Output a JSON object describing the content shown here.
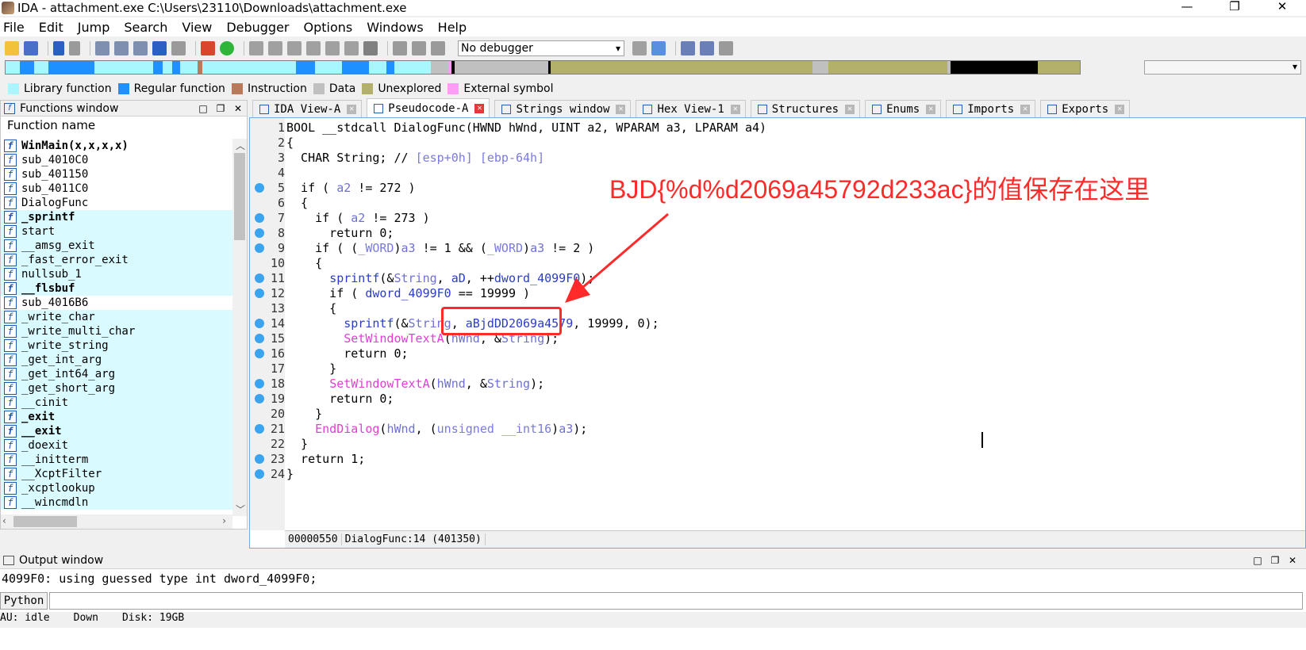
{
  "window": {
    "title": "IDA - attachment.exe C:\\Users\\23110\\Downloads\\attachment.exe",
    "min_label": "—",
    "max_label": "❐",
    "close_label": "✕"
  },
  "menu": [
    "File",
    "Edit",
    "Jump",
    "Search",
    "View",
    "Debugger",
    "Options",
    "Windows",
    "Help"
  ],
  "toolbar": {
    "debugger_select": "No debugger"
  },
  "legend": [
    {
      "label": "Library function",
      "color": "#aaf6ff"
    },
    {
      "label": "Regular function",
      "color": "#1e90ff"
    },
    {
      "label": "Instruction",
      "color": "#b87a5a"
    },
    {
      "label": "Data",
      "color": "#c0c0c0"
    },
    {
      "label": "Unexplored",
      "color": "#b2b06a"
    },
    {
      "label": "External symbol",
      "color": "#ff9cf5"
    }
  ],
  "functions_window": {
    "title": "Functions window",
    "column": "Function name",
    "items": [
      {
        "name": "WinMain(x,x,x,x)",
        "lib": false,
        "bold": true
      },
      {
        "name": "sub_4010C0",
        "lib": false,
        "bold": false
      },
      {
        "name": "sub_401150",
        "lib": false,
        "bold": false
      },
      {
        "name": "sub_4011C0",
        "lib": false,
        "bold": false
      },
      {
        "name": "DialogFunc",
        "lib": false,
        "bold": false
      },
      {
        "name": "_sprintf",
        "lib": true,
        "bold": true
      },
      {
        "name": "start",
        "lib": true,
        "bold": false
      },
      {
        "name": "__amsg_exit",
        "lib": true,
        "bold": false
      },
      {
        "name": "_fast_error_exit",
        "lib": true,
        "bold": false
      },
      {
        "name": "nullsub_1",
        "lib": true,
        "bold": false
      },
      {
        "name": "__flsbuf",
        "lib": true,
        "bold": true
      },
      {
        "name": "sub_4016B6",
        "lib": false,
        "bold": false
      },
      {
        "name": "_write_char",
        "lib": true,
        "bold": false
      },
      {
        "name": "_write_multi_char",
        "lib": true,
        "bold": false
      },
      {
        "name": "_write_string",
        "lib": true,
        "bold": false
      },
      {
        "name": "_get_int_arg",
        "lib": true,
        "bold": false
      },
      {
        "name": "_get_int64_arg",
        "lib": true,
        "bold": false
      },
      {
        "name": "_get_short_arg",
        "lib": true,
        "bold": false
      },
      {
        "name": "__cinit",
        "lib": true,
        "bold": false
      },
      {
        "name": "_exit",
        "lib": true,
        "bold": true
      },
      {
        "name": "__exit",
        "lib": true,
        "bold": true
      },
      {
        "name": "_doexit",
        "lib": true,
        "bold": false
      },
      {
        "name": "__initterm",
        "lib": true,
        "bold": false
      },
      {
        "name": "__XcptFilter",
        "lib": true,
        "bold": false
      },
      {
        "name": "_xcptlookup",
        "lib": true,
        "bold": false
      },
      {
        "name": "__wincmdln",
        "lib": true,
        "bold": false
      }
    ]
  },
  "tabs": [
    {
      "label": "IDA View-A",
      "active": false
    },
    {
      "label": "Pseudocode-A",
      "active": true
    },
    {
      "label": "Strings window",
      "active": false
    },
    {
      "label": "Hex View-1",
      "active": false
    },
    {
      "label": "Structures",
      "active": false
    },
    {
      "label": "Enums",
      "active": false
    },
    {
      "label": "Imports",
      "active": false
    },
    {
      "label": "Exports",
      "active": false
    }
  ],
  "code": [
    {
      "n": "1",
      "dot": false,
      "html": "BOOL __stdcall DialogFunc(HWND hWnd, UINT a2, WPARAM a3, LPARAM a4)"
    },
    {
      "n": "2",
      "dot": false,
      "html": "{"
    },
    {
      "n": "3",
      "dot": false,
      "html": "  CHAR String; // <span class='cmt'>[esp+0h] [ebp-64h]</span>"
    },
    {
      "n": "4",
      "dot": false,
      "html": ""
    },
    {
      "n": "5",
      "dot": true,
      "html": "  if ( <span class='var'>a2</span> != 272 )"
    },
    {
      "n": "6",
      "dot": false,
      "html": "  {"
    },
    {
      "n": "7",
      "dot": true,
      "html": "    if ( <span class='var'>a2</span> != 273 )"
    },
    {
      "n": "8",
      "dot": true,
      "html": "      return 0;"
    },
    {
      "n": "9",
      "dot": true,
      "html": "    if ( (<span class='cmt'>_WORD</span>)<span class='var'>a3</span> != 1 && (<span class='cmt'>_WORD</span>)<span class='var'>a3</span> != 2 )"
    },
    {
      "n": "10",
      "dot": false,
      "html": "    {"
    },
    {
      "n": "11",
      "dot": true,
      "html": "      <span class='fn'>sprintf</span>(&<span class='var'>String</span>, <span class='fn'>aD</span>, ++<span class='fn'>dword_4099F0</span>);"
    },
    {
      "n": "12",
      "dot": true,
      "html": "      if ( <span class='fn'>dword_4099F0</span> == 19999 )"
    },
    {
      "n": "13",
      "dot": false,
      "html": "      {"
    },
    {
      "n": "14",
      "dot": true,
      "html": "        <span class='fn'>sprintf</span>(&<span class='var'>String</span>, <span class='fn'>aBjdDD2069a4579</span>, 19999, 0);"
    },
    {
      "n": "15",
      "dot": true,
      "html": "        <span class='api'>SetWindowTextA</span>(<span class='var'>hWnd</span>, &<span class='var'>String</span>);"
    },
    {
      "n": "16",
      "dot": true,
      "html": "        return 0;"
    },
    {
      "n": "17",
      "dot": false,
      "html": "      }"
    },
    {
      "n": "18",
      "dot": true,
      "html": "      <span class='api'>SetWindowTextA</span>(<span class='var'>hWnd</span>, &<span class='var'>String</span>);"
    },
    {
      "n": "19",
      "dot": true,
      "html": "      return 0;"
    },
    {
      "n": "20",
      "dot": false,
      "html": "    }"
    },
    {
      "n": "21",
      "dot": true,
      "html": "    <span class='api'>EndDialog</span>(<span class='var'>hWnd</span>, (<span class='cmt'>unsigned __int16</span>)<span class='var'>a3</span>);"
    },
    {
      "n": "22",
      "dot": false,
      "html": "  }"
    },
    {
      "n": "23",
      "dot": true,
      "html": "  return 1;"
    },
    {
      "n": "24",
      "dot": true,
      "html": "}"
    }
  ],
  "code_status": {
    "address": "00000550",
    "location": "DialogFunc:14 (401350)"
  },
  "annotation": "BJD{%d%d2069a45792d233ac}的值保存在这里",
  "output": {
    "title": "Output window",
    "line": "4099F0: using guessed type int dword_4099F0;",
    "python_label": "Python"
  },
  "statusbar": {
    "au": "AU:  idle",
    "down": "Down",
    "disk": "Disk: 19GB"
  }
}
